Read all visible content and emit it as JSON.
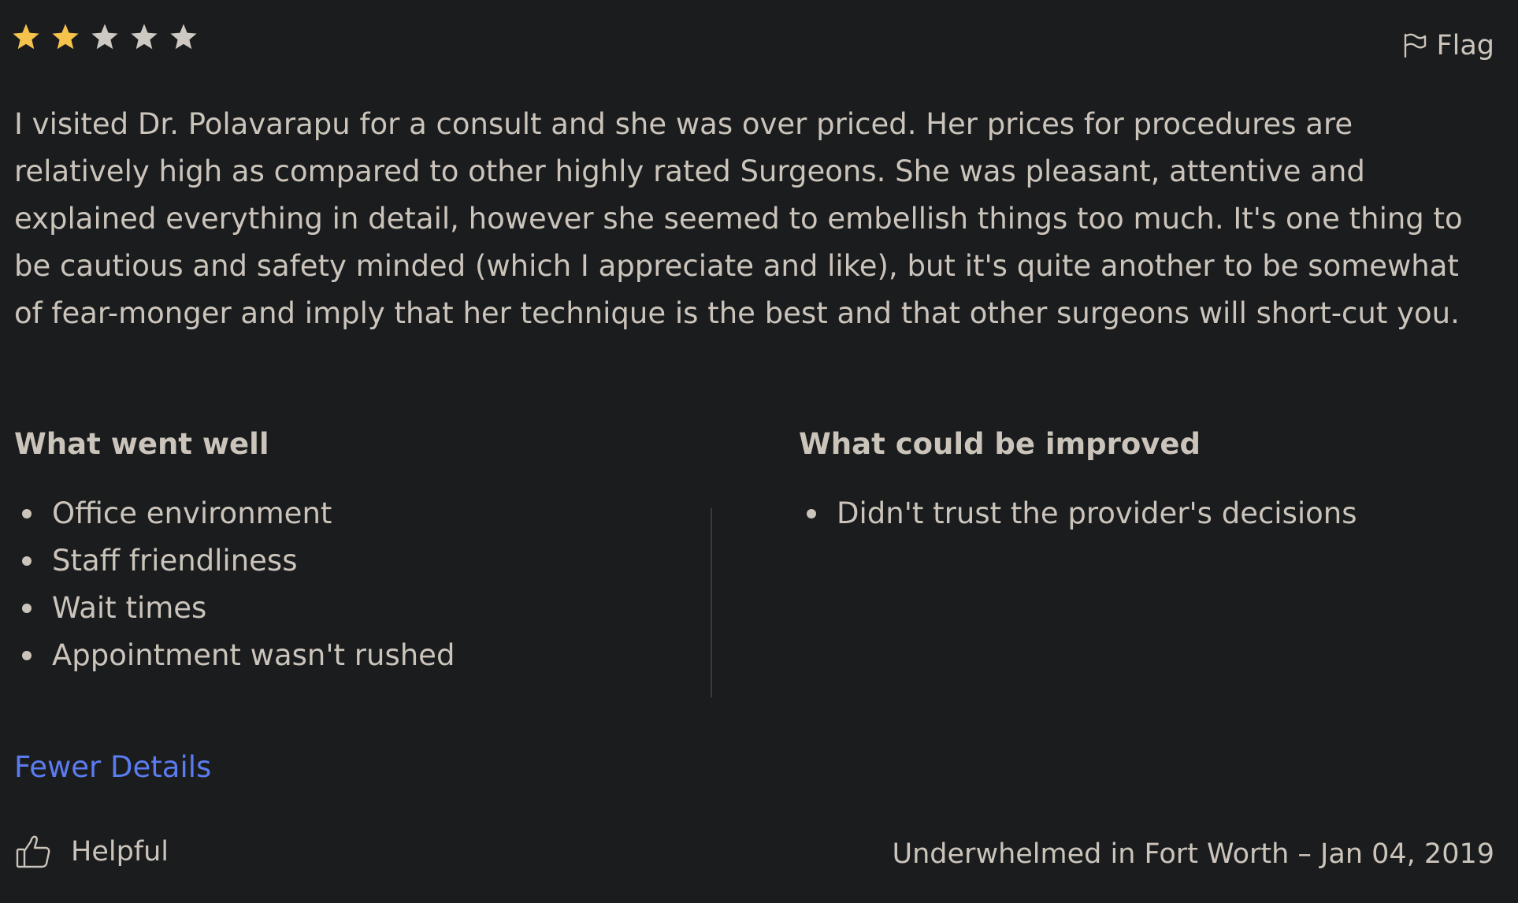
{
  "rating": {
    "value": 2,
    "max": 5,
    "filled_color": "#f5c24c",
    "empty_color": "#cdc8c1"
  },
  "flag": {
    "label": "Flag",
    "icon": "flag-icon"
  },
  "review": {
    "text": "I visited Dr. Polavarapu for a consult and she was over priced. Her prices for procedures are relatively high as compared to other highly rated Surgeons. She was pleasant, attentive and explained everything in detail, however she seemed to embellish things too much. It's one thing to be cautious and safety minded (which I appreciate and like), but it's quite another to be somewhat of fear-monger and imply that her technique is the best and that other surgeons will short-cut you."
  },
  "went_well": {
    "heading": "What went well",
    "items": [
      "Office environment",
      "Staff friendliness",
      "Wait times",
      "Appointment wasn't rushed"
    ]
  },
  "improved": {
    "heading": "What could be improved",
    "items": [
      "Didn't trust the provider's decisions"
    ]
  },
  "fewer_details": {
    "label": "Fewer Details",
    "color": "#5b7cf0"
  },
  "helpful": {
    "label": "Helpful",
    "icon": "thumbs-up-icon"
  },
  "author": {
    "line": "Underwhelmed in Fort Worth – Jan 04, 2019"
  }
}
